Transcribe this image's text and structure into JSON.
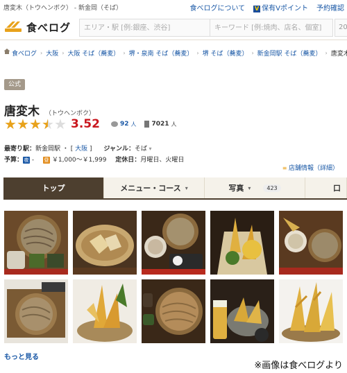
{
  "topbar": {
    "crumb": "唐変木（トウヘンボク） - 新金岡（そば）",
    "links": [
      "食べログについて",
      "保有Vポイント",
      "予約確認"
    ],
    "vmark": "V"
  },
  "header": {
    "logo": "食べログ",
    "area_placeholder": "エリア・駅 [例:銀座、渋谷]",
    "keyword_placeholder": "キーワード [例:焼肉、店名、個室]",
    "extra": "20"
  },
  "breadcrumb": [
    "食べログ",
    "大阪",
    "大阪 そば（蕎麦）",
    "堺・泉南 そば（蕎麦）",
    "堺 そば（蕎麦）",
    "新金岡駅 そば（蕎麦）",
    "唐変木"
  ],
  "badge": "公式",
  "restaurant": {
    "name": "唐変木",
    "kana": "（トウヘンボク）",
    "rating": 3.52,
    "rating_text": "3.52",
    "reviews": "92",
    "reviews_unit": "人",
    "saves": "7021",
    "saves_unit": "人"
  },
  "info": {
    "station_label": "最寄り駅：",
    "station": "新金岡駅",
    "station_sep": " ・ [",
    "station_area": " 大阪 ",
    "station_close": "]",
    "genre_label": "ジャンル：",
    "genre": "そば",
    "budget_label": "予算：",
    "budget_night": "-",
    "budget_day": "￥1,000～￥1,999",
    "closed_label": "定休日：",
    "closed": "月曜日、火曜日"
  },
  "shop_info_link": "店舗情報（詳細）",
  "tabs": [
    {
      "label": "トップ"
    },
    {
      "label": "メニュー・コース"
    },
    {
      "label": "写真",
      "count": "423"
    },
    {
      "label": "口"
    }
  ],
  "photos": [
    {
      "icon": "zaru-soba-photo"
    },
    {
      "icon": "tempura-basket-photo"
    },
    {
      "icon": "soba-set-photo"
    },
    {
      "icon": "vegetable-tempura-photo"
    },
    {
      "icon": "soba-meal-photo"
    },
    {
      "icon": "zaru-soba-wood-photo"
    },
    {
      "icon": "shrimp-tempura-photo"
    },
    {
      "icon": "seiro-soba-photo"
    },
    {
      "icon": "beer-tempura-photo"
    },
    {
      "icon": "large-tempura-photo"
    }
  ],
  "more_link": "もっと見る",
  "credit": "※画像は食べログより",
  "colors": {
    "link": "#1a58a6",
    "score": "#c9171e",
    "star": "#e8a21b",
    "tab_active": "#4d3f2f",
    "badge": "#a4998a"
  }
}
